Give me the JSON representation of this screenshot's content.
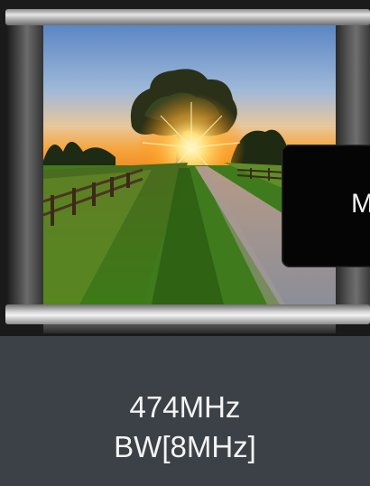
{
  "thumbnail": {
    "scene": "tree-at-sunset-landscape"
  },
  "overlay": {
    "label_fragment": "M"
  },
  "channel_info": {
    "frequency": "474MHz",
    "bandwidth": "BW[8MHz]"
  },
  "colors": {
    "panel_background": "#3c4147",
    "panel_text": "#f4f4f4",
    "overlay_background": "#050505"
  }
}
